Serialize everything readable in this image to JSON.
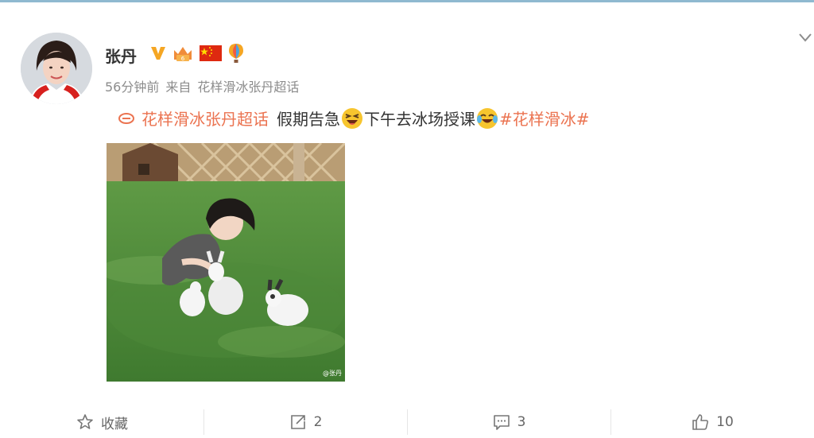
{
  "post": {
    "author": "张丹",
    "time": "56分钟前",
    "source_prefix": "来自",
    "source": "花样滑冰张丹超话",
    "topic_link": "花样滑冰张丹超话",
    "text_1": "假期告急",
    "text_2": "下午去冰场授课",
    "hashtag": "#花样滑冰#",
    "photo_watermark": "@张丹"
  },
  "actions": {
    "favorite": "收藏",
    "repost_count": "2",
    "comment_count": "3",
    "like_count": "10"
  },
  "colors": {
    "accent": "#eb7350",
    "verified": "#f5a623",
    "muted": "#8c8c8c"
  },
  "icons": [
    "verified-v-icon",
    "vip-crown-icon",
    "china-flag-icon",
    "balloon-icon",
    "topic-link-icon",
    "laughing-emoji-icon",
    "tears-of-joy-emoji-icon",
    "star-icon",
    "repost-icon",
    "comment-icon",
    "thumbs-up-icon",
    "chevron-down-icon"
  ]
}
